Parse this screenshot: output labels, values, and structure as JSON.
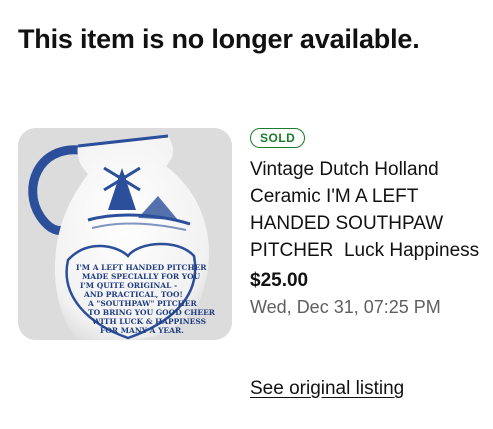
{
  "page": {
    "heading": "This item is no longer available."
  },
  "listing": {
    "status_badge": "SOLD",
    "title": "Vintage Dutch Holland Ceramic I'M A LEFT HANDED SOUTHPAW PITCHER  Luck Happiness",
    "price": "$25.00",
    "ended_date": "Wed, Dec 31, 07:25 PM",
    "link_label": "See original listing",
    "image_icon": "pitcher-photo",
    "image_text": [
      "I'M A LEFT HANDED PITCHER",
      "MADE SPECIALLY FOR YOU",
      "I'M QUITE ORIGINAL -",
      "AND PRACTICAL, TOO!",
      "A \"SOUTHPAW\" PITCHER",
      "TO BRING YOU GOOD CHEER",
      "WITH LUCK & HAPPINESS",
      "FOR MANY A YEAR."
    ]
  },
  "colors": {
    "sold_green": "#1a7c2d",
    "delft_blue": "#2b4f9a",
    "muted_text": "#5f5f5f"
  }
}
